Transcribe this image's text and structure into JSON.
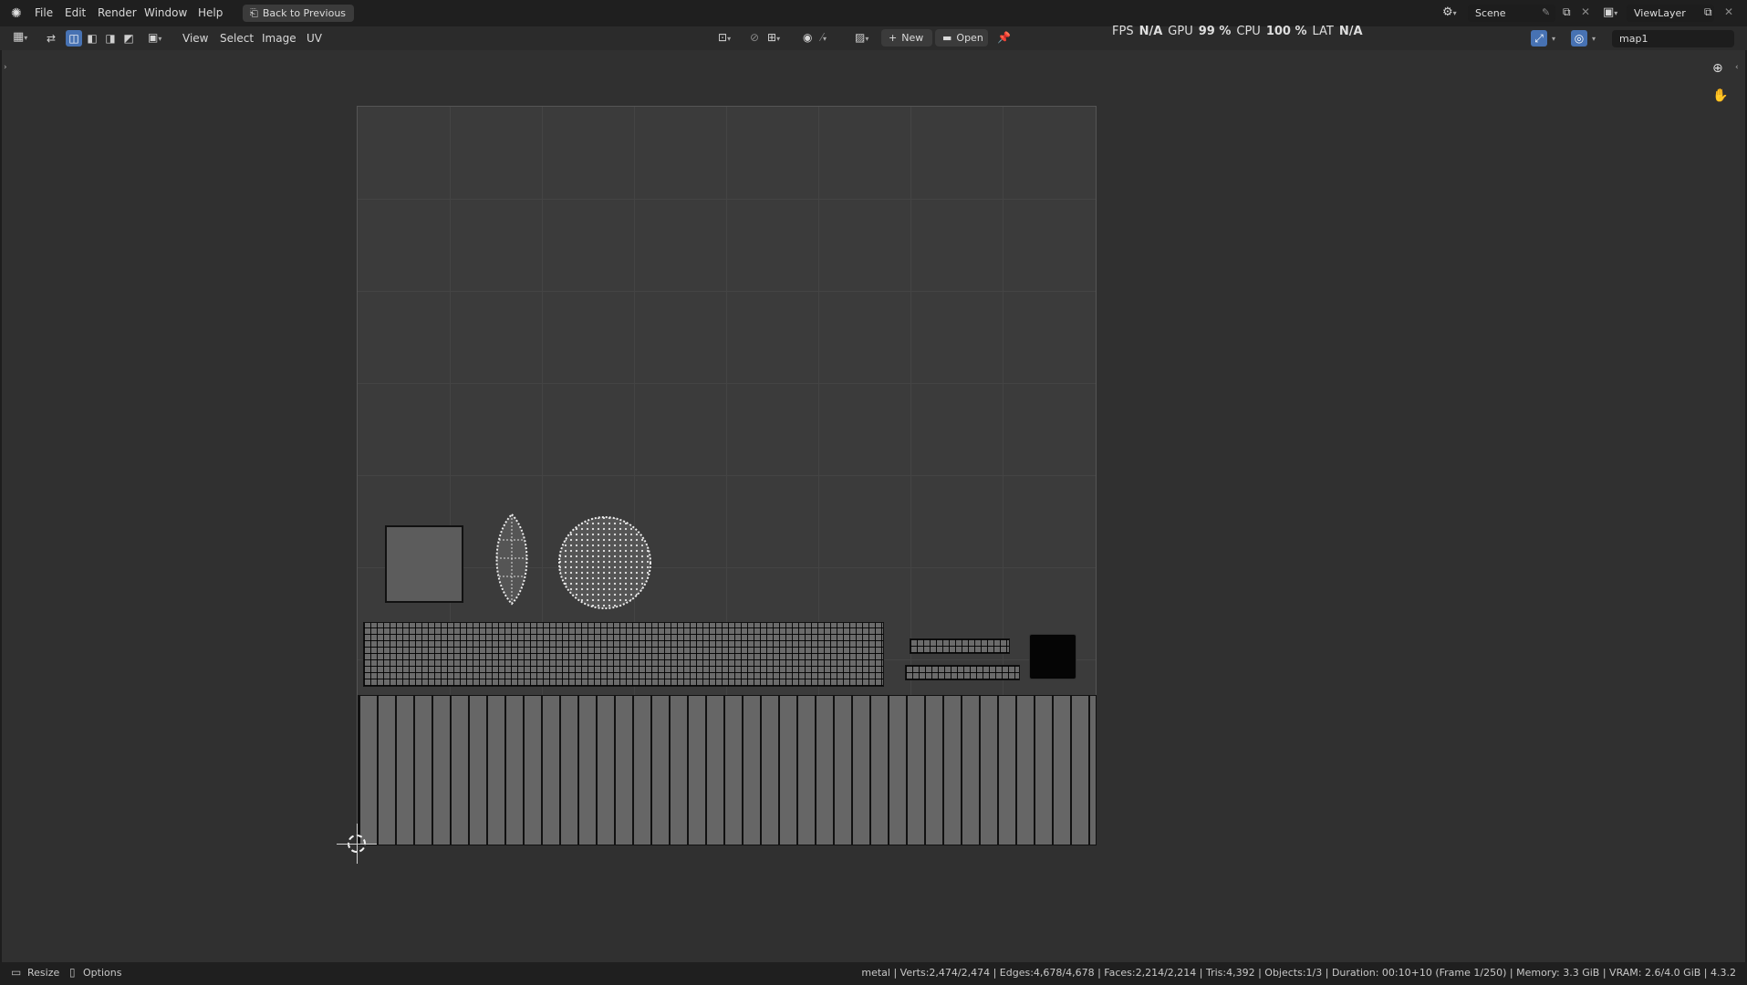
{
  "menu": {
    "file": "File",
    "edit": "Edit",
    "render": "Render",
    "window": "Window",
    "help": "Help",
    "back_button": "Back to Previous"
  },
  "topbar_right": {
    "scene": "Scene",
    "view_layer": "ViewLayer"
  },
  "performance": {
    "fps_label": "FPS",
    "fps_value": "N/A",
    "gpu_label": "GPU",
    "gpu_value": "99 %",
    "cpu_label": "CPU",
    "cpu_value": "100 %",
    "lat_label": "LAT",
    "lat_value": "N/A"
  },
  "header": {
    "view": "View",
    "select": "Select",
    "image": "Image",
    "uv": "UV",
    "new_button": "New",
    "open_button": "Open",
    "uv_map": "map1"
  },
  "statusbar": {
    "resize": "Resize",
    "options": "Options",
    "stats": "metal | Verts:2,474/2,474 | Edges:4,678/4,678 | Faces:2,214/2,214 | Tris:4,392 | Objects:1/3 | Duration: 00:10+10 (Frame 1/250) | Memory: 3.3 GiB | VRAM: 2.6/4.0 GiB | 4.3.2"
  },
  "colors": {
    "accent": "#4772b3",
    "panel": "#2b2b2b",
    "viewport": "#303030"
  }
}
